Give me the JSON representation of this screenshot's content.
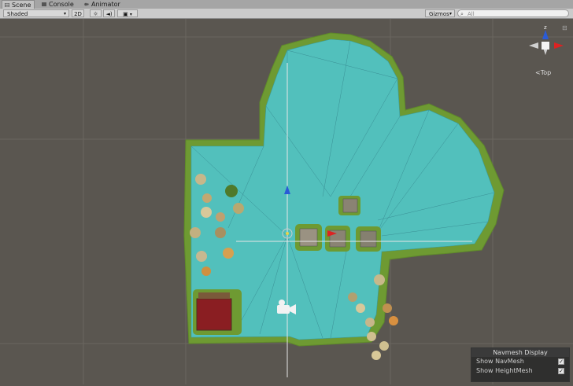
{
  "tabs": [
    {
      "label": "Scene",
      "icon": "scene-icon",
      "active": true
    },
    {
      "label": "Console",
      "icon": "console-icon",
      "active": false
    },
    {
      "label": "Animator",
      "icon": "animator-icon",
      "active": false
    }
  ],
  "toolbar": {
    "shading_mode": "Shaded",
    "mode_2d": "2D",
    "gizmos_label": "Gizmos",
    "search_placeholder": "All"
  },
  "gizmo": {
    "axis_label": "z",
    "view_label": "Top"
  },
  "navmesh_panel": {
    "title": "Navmesh Display",
    "options": [
      {
        "label": "Show NavMesh",
        "checked": true
      },
      {
        "label": "Show HeightMesh",
        "checked": true
      }
    ]
  },
  "colors": {
    "background": "#5a5650",
    "navmesh": "#4fc3c8",
    "ground": "#6e9a32"
  }
}
